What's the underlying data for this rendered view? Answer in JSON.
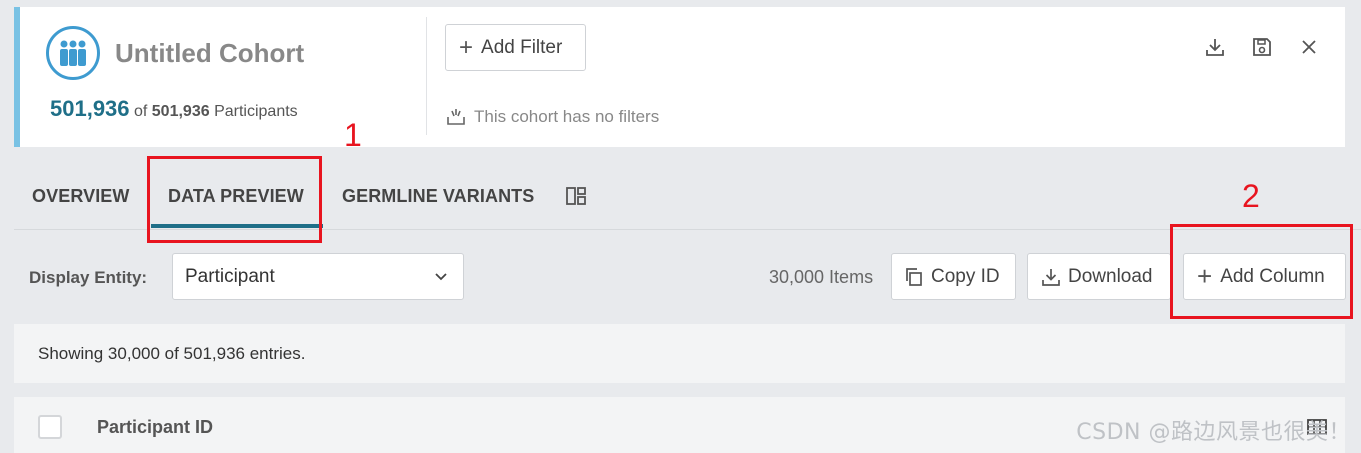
{
  "cohort": {
    "title": "Untitled Cohort",
    "count": "501,936",
    "of_label": "of",
    "total": "501,936",
    "participants_label": "Participants",
    "add_filter_label": "Add Filter",
    "no_filters_text": "This cohort has no filters",
    "actions": [
      "download-icon",
      "save-icon",
      "close-icon"
    ]
  },
  "tabs": [
    {
      "label": "OVERVIEW",
      "active": false
    },
    {
      "label": "DATA PREVIEW",
      "active": true
    },
    {
      "label": "GERMLINE VARIANTS",
      "active": false
    }
  ],
  "toolbar": {
    "entity_label": "Display Entity:",
    "entity_value": "Participant",
    "items_count": "30,000 Items",
    "copy_id_label": "Copy ID",
    "download_label": "Download",
    "add_column_label": "Add Column"
  },
  "entries_text": "Showing 30,000 of 501,936 entries.",
  "table": {
    "columns": [
      "Participant ID"
    ]
  },
  "annotations": [
    "1",
    "2"
  ],
  "watermark": "CSDN @路边风景也很美！",
  "colors": {
    "accent": "#1f6f88",
    "cohort_border": "#79c2e4",
    "annotation_red": "#e8141f"
  }
}
